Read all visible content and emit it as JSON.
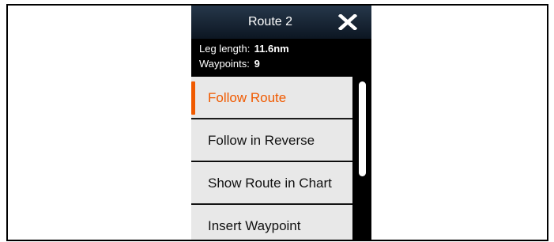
{
  "dialog": {
    "title": "Route 2",
    "close_icon": "close-x-icon"
  },
  "info": {
    "leg_length_label": "Leg length:",
    "leg_length_value": "11.6nm",
    "waypoints_label": "Waypoints:",
    "waypoints_value": "9"
  },
  "menu": {
    "items": [
      {
        "label": "Follow Route",
        "selected": true
      },
      {
        "label": "Follow in Reverse",
        "selected": false
      },
      {
        "label": "Show Route in Chart",
        "selected": false
      },
      {
        "label": "Insert Waypoint",
        "selected": false
      }
    ]
  },
  "colors": {
    "accent": "#f05a00",
    "titlebar": "#1a2838",
    "menu_bg": "#e8e8e8",
    "panel_bg": "#000000"
  }
}
